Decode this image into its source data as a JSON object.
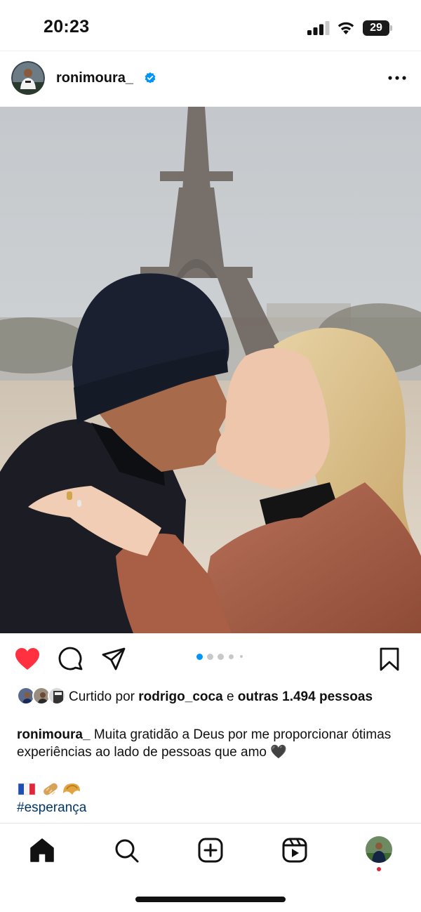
{
  "status_bar": {
    "time": "20:23",
    "battery": "29",
    "icons": [
      "signal-icon",
      "wifi-icon",
      "battery-icon"
    ]
  },
  "post": {
    "username": "ronimoura_",
    "verified": true,
    "photo_description_icon": "couple-kiss-eiffel-photo",
    "carousel": {
      "count": 5,
      "active": 1
    },
    "liked": true,
    "likes": {
      "prefix": "Curtido por",
      "user": "rodrigo_coca",
      "joiner": "e",
      "others": "outras 1.494",
      "suffix": "pessoas"
    },
    "caption": {
      "username": "ronimoura_",
      "text": "Muita gratidão a Deus por me proporcionar ótimas experiências ao lado de pessoas que amo 🖤",
      "emojis": "🇫🇷🥖🥐",
      "hashtag": "#esperança"
    }
  },
  "nav": {
    "items": [
      "home-icon",
      "search-icon",
      "create-icon",
      "reels-icon",
      "profile-avatar"
    ],
    "profile_notification": true
  },
  "colors": {
    "like_red": "#ff3040",
    "carousel_active": "#0095f6",
    "verified_blue": "#0095f6",
    "hashtag": "#00376b"
  }
}
